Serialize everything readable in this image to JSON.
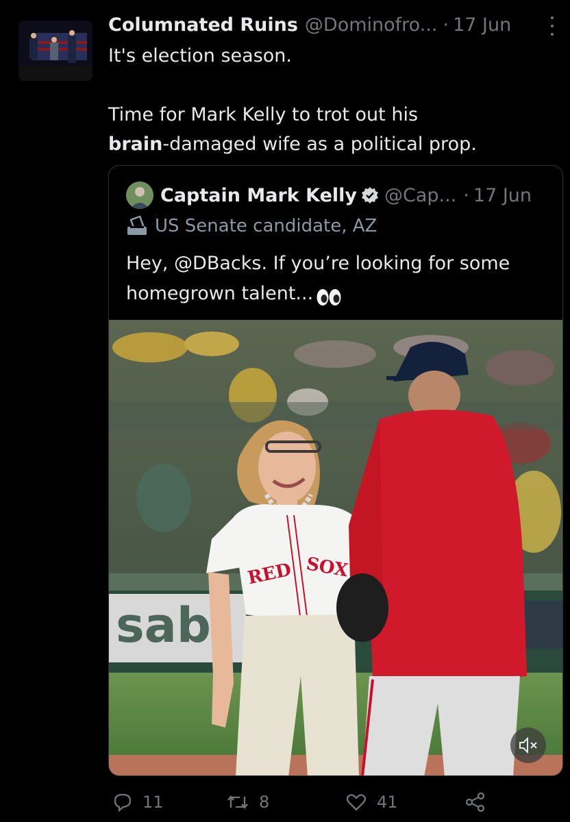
{
  "tweet": {
    "author_name": "Columnated Ruins",
    "author_handle": "@Dominofro...",
    "separator": "·",
    "time": "17 Jun",
    "text_line1": "It's election season.",
    "text_line2_pre": "Time for Mark Kelly to trot out his",
    "text_line3_bold": "brain",
    "text_line3_rest": "-damaged wife as a political prop."
  },
  "quote": {
    "author_name": "Captain Mark Kelly",
    "author_handle": "@Cap...",
    "separator": "·",
    "time": "17 Jun",
    "label": "US Senate candidate, AZ",
    "text_line1": "Hey, @DBacks. If you’re looking for some",
    "text_line2": "homegrown talent...",
    "jersey_text_left": "RED",
    "jersey_text_right": "SOX"
  },
  "actions": {
    "replies": "11",
    "retweets": "8",
    "likes": "41"
  },
  "colors": {
    "background": "#000000",
    "text": "#e7e9ea",
    "muted": "#71767b",
    "border": "#2f3336",
    "jersey_red": "#c8102e"
  }
}
